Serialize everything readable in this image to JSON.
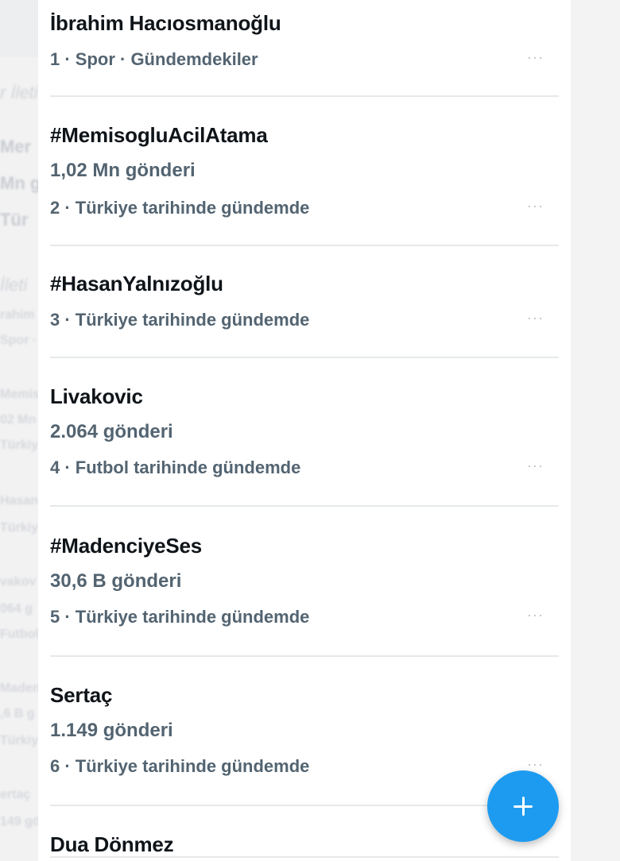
{
  "trends": [
    {
      "title": "İbrahim Hacıosmanoğlu",
      "count": "",
      "meta": "1 · Spor · Gündemdekiler"
    },
    {
      "title": "#MemisogluAcilAtama",
      "count": "1,02 Mn gönderi",
      "meta": "2 · Türkiye tarihinde gündemde"
    },
    {
      "title": "#HasanYalnızoğlu",
      "count": "",
      "meta": "3 · Türkiye tarihinde gündemde"
    },
    {
      "title": "Livakovic",
      "count": "2.064 gönderi",
      "meta": "4 · Futbol tarihinde gündemde"
    },
    {
      "title": "#MadenciyeSes",
      "count": "30,6 B gönderi",
      "meta": "5 · Türkiye tarihinde gündemde"
    },
    {
      "title": "Sertaç",
      "count": "1.149 gönderi",
      "meta": "6 · Türkiye tarihinde gündemde"
    },
    {
      "title": "Dua Dönmez",
      "count": "",
      "meta": ""
    }
  ],
  "more_label": "···",
  "background_ghost_text": [
    "r İleti",
    "Mer",
    "Mn g",
    "Tür",
    "İleti",
    "rahim",
    "Spor ·",
    "Memis",
    "02 Mn",
    "Türkiy",
    "Hasan",
    "Türkiy",
    "vakov",
    "064 g",
    "Futbol",
    "Maden",
    ",6 B g",
    "Türkiy",
    "ertaç",
    "149 gö"
  ],
  "icons": {
    "compose": "plus-icon",
    "more": "more-dots-icon"
  },
  "colors": {
    "accent": "#1d9bf0",
    "primary_text": "#0f1419",
    "secondary_text": "#536471"
  }
}
